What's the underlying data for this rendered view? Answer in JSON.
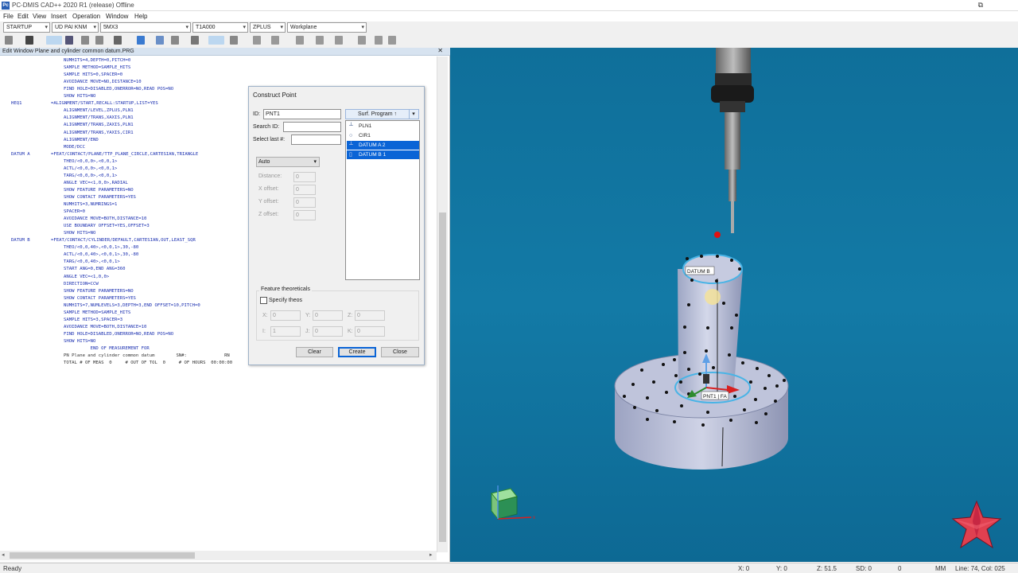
{
  "window": {
    "title": "PC-DMIS CAD++ 2020 R1 (release)   Offline",
    "app_icon": "Pc"
  },
  "menu": [
    "File",
    "Edit",
    "View",
    "Insert",
    "Operation",
    "Window",
    "Help"
  ],
  "combos": [
    {
      "value": "STARTUP"
    },
    {
      "value": "UD PAI KNM"
    },
    {
      "value": "5MX3"
    },
    {
      "value": "T1A000"
    },
    {
      "value": "ZPLUS"
    },
    {
      "value": "Workplane"
    }
  ],
  "edit_window": {
    "title": "Edit Window   Plane and cylinder common datum.PRG",
    "lines": [
      {
        "l": "",
        "t": "NUMHITS=4,DEPTH=0,PITCH=0"
      },
      {
        "l": "",
        "t": "SAMPLE METHOD=SAMPLE_HITS"
      },
      {
        "l": "",
        "t": "SAMPLE HITS=0,SPACER=0"
      },
      {
        "l": "",
        "t": "AVOIDANCE MOVE=NO,DISTANCE=10"
      },
      {
        "l": "",
        "t": "FIND HOLE=DISABLED,ONERROR=NO,READ POS=NO"
      },
      {
        "l": "",
        "t": "SHOW HITS=NO"
      },
      {
        "l": "HEQ1",
        "t": "=ALIGNMENT/START,RECALL:STARTUP,LIST=YES"
      },
      {
        "l": "",
        "t": "ALIGNMENT/LEVEL,ZPLUS,PLN1"
      },
      {
        "l": "",
        "t": "ALIGNMENT/TRANS,XAXIS,PLN1"
      },
      {
        "l": "",
        "t": "ALIGNMENT/TRANS,ZAXIS,PLN1"
      },
      {
        "l": "",
        "t": "ALIGNMENT/TRANS,YAXIS,CIR1"
      },
      {
        "l": "",
        "t": "ALIGNMENT/END"
      },
      {
        "l": "",
        "t": "MODE/DCC"
      },
      {
        "l": "DATUM A",
        "t": "=FEAT/CONTACT/PLANE/TTP_PLANE_CIRCLE,CARTESIAN,TRIANGLE"
      },
      {
        "l": "",
        "t": "THEO/<0,0,0>,<0,0,1>"
      },
      {
        "l": "",
        "t": "ACTL/<0,0,0>,<0,0,1>"
      },
      {
        "l": "",
        "t": "TARG/<0,0,0>,<0,0,1>"
      },
      {
        "l": "",
        "t": "ANGLE VEC=<1,0,0>,RADIAL"
      },
      {
        "l": "",
        "t": "SHOW FEATURE PARAMETERS=NO"
      },
      {
        "l": "",
        "t": "SHOW CONTACT PARAMETERS=YES"
      },
      {
        "l": "",
        "t": "NUMHITS=3,NUMRINGS=1"
      },
      {
        "l": "",
        "t": "SPACER=0"
      },
      {
        "l": "",
        "t": "AVOIDANCE MOVE=BOTH,DISTANCE=10"
      },
      {
        "l": "",
        "t": "USE BOUNDARY OFFSET=YES,OFFSET=3"
      },
      {
        "l": "",
        "t": "SHOW HITS=NO"
      },
      {
        "l": "DATUM B",
        "t": "=FEAT/CONTACT/CYLINDER/DEFAULT,CARTESIAN,OUT,LEAST_SQR"
      },
      {
        "l": "",
        "t": "THEO/<0,0,40>,<0,0,1>,30,-80"
      },
      {
        "l": "",
        "t": "ACTL/<0,0,40>,<0,0,1>,30,-80"
      },
      {
        "l": "",
        "t": "TARG/<0,0,40>,<0,0,1>"
      },
      {
        "l": "",
        "t": "START ANG=0,END ANG=360"
      },
      {
        "l": "",
        "t": "ANGLE VEC=<1,0,0>"
      },
      {
        "l": "",
        "t": "DIRECTION=CCW"
      },
      {
        "l": "",
        "t": "SHOW FEATURE PARAMETERS=NO"
      },
      {
        "l": "",
        "t": "SHOW CONTACT PARAMETERS=YES"
      },
      {
        "l": "",
        "t": "NUMHITS=7,NUMLEVELS=3,DEPTH=3,END OFFSET=10,PITCH=0"
      },
      {
        "l": "",
        "t": "SAMPLE METHOD=SAMPLE_HITS"
      },
      {
        "l": "",
        "t": "SAMPLE HITS=3,SPACER=3"
      },
      {
        "l": "",
        "t": "AVOIDANCE MOVE=BOTH,DISTANCE=10"
      },
      {
        "l": "",
        "t": "FIND HOLE=DISABLED,ONERROR=NO,READ POS=NO"
      },
      {
        "l": "",
        "t": "SHOW HITS=NO"
      },
      {
        "l": "",
        "t": "          END OF MEASUREMENT FOR"
      },
      {
        "l": "",
        "t": "PN Plane and cylinder common datum        SN#:              RN"
      },
      {
        "l": "",
        "t": "TOTAL # OF MEAS  0     # OUT OF TOL  0     # OF HOURS  00:00:00"
      }
    ]
  },
  "construct_point": {
    "title": "Construct Point",
    "id_label": "ID:",
    "id_value": "PNT1",
    "search_label": "Search ID:",
    "search_value": "",
    "select_last_label": "Select last #:",
    "select_last_value": "",
    "mode_combo": "Auto",
    "program_combo": "Surf. Program ↑",
    "features": [
      {
        "name": "PLN1",
        "icon": "plane",
        "selected": false
      },
      {
        "name": "CIR1",
        "icon": "circle",
        "selected": false
      },
      {
        "name": "DATUM A     2",
        "icon": "plane",
        "selected": true
      },
      {
        "name": "DATUM B     1",
        "icon": "cylinder",
        "selected": true
      }
    ],
    "offsets": [
      {
        "label": "Distance:",
        "value": "0"
      },
      {
        "label": "X offset:",
        "value": "0"
      },
      {
        "label": "Y offset:",
        "value": "0"
      },
      {
        "label": "Z offset:",
        "value": "0"
      }
    ],
    "group_title": "Feature theoreticals",
    "specify_label": "Specify theos",
    "theo_xyz": [
      {
        "label": "X:",
        "value": "0"
      },
      {
        "label": "Y:",
        "value": "0"
      },
      {
        "label": "Z:",
        "value": "0"
      }
    ],
    "theo_ijk": [
      {
        "label": "I:",
        "value": "1"
      },
      {
        "label": "J:",
        "value": "0"
      },
      {
        "label": "K:",
        "value": "0"
      }
    ],
    "buttons": {
      "clear": "Clear",
      "create": "Create",
      "close": "Close"
    }
  },
  "viewport": {
    "labels": {
      "datum": "DATUM B",
      "point": "PNT1 | FA"
    },
    "colors": {
      "background": "#137aa6",
      "part": "#b9bfd6",
      "stylus_tip": "#e01010"
    }
  },
  "statusbar": {
    "status": "Ready",
    "x": "X: 0",
    "y": "Y: 0",
    "z": "Z: 51.5",
    "sd": "SD: 0",
    "val": "0",
    "units": "MM",
    "line_col": "Line: 74, Col: 025"
  }
}
